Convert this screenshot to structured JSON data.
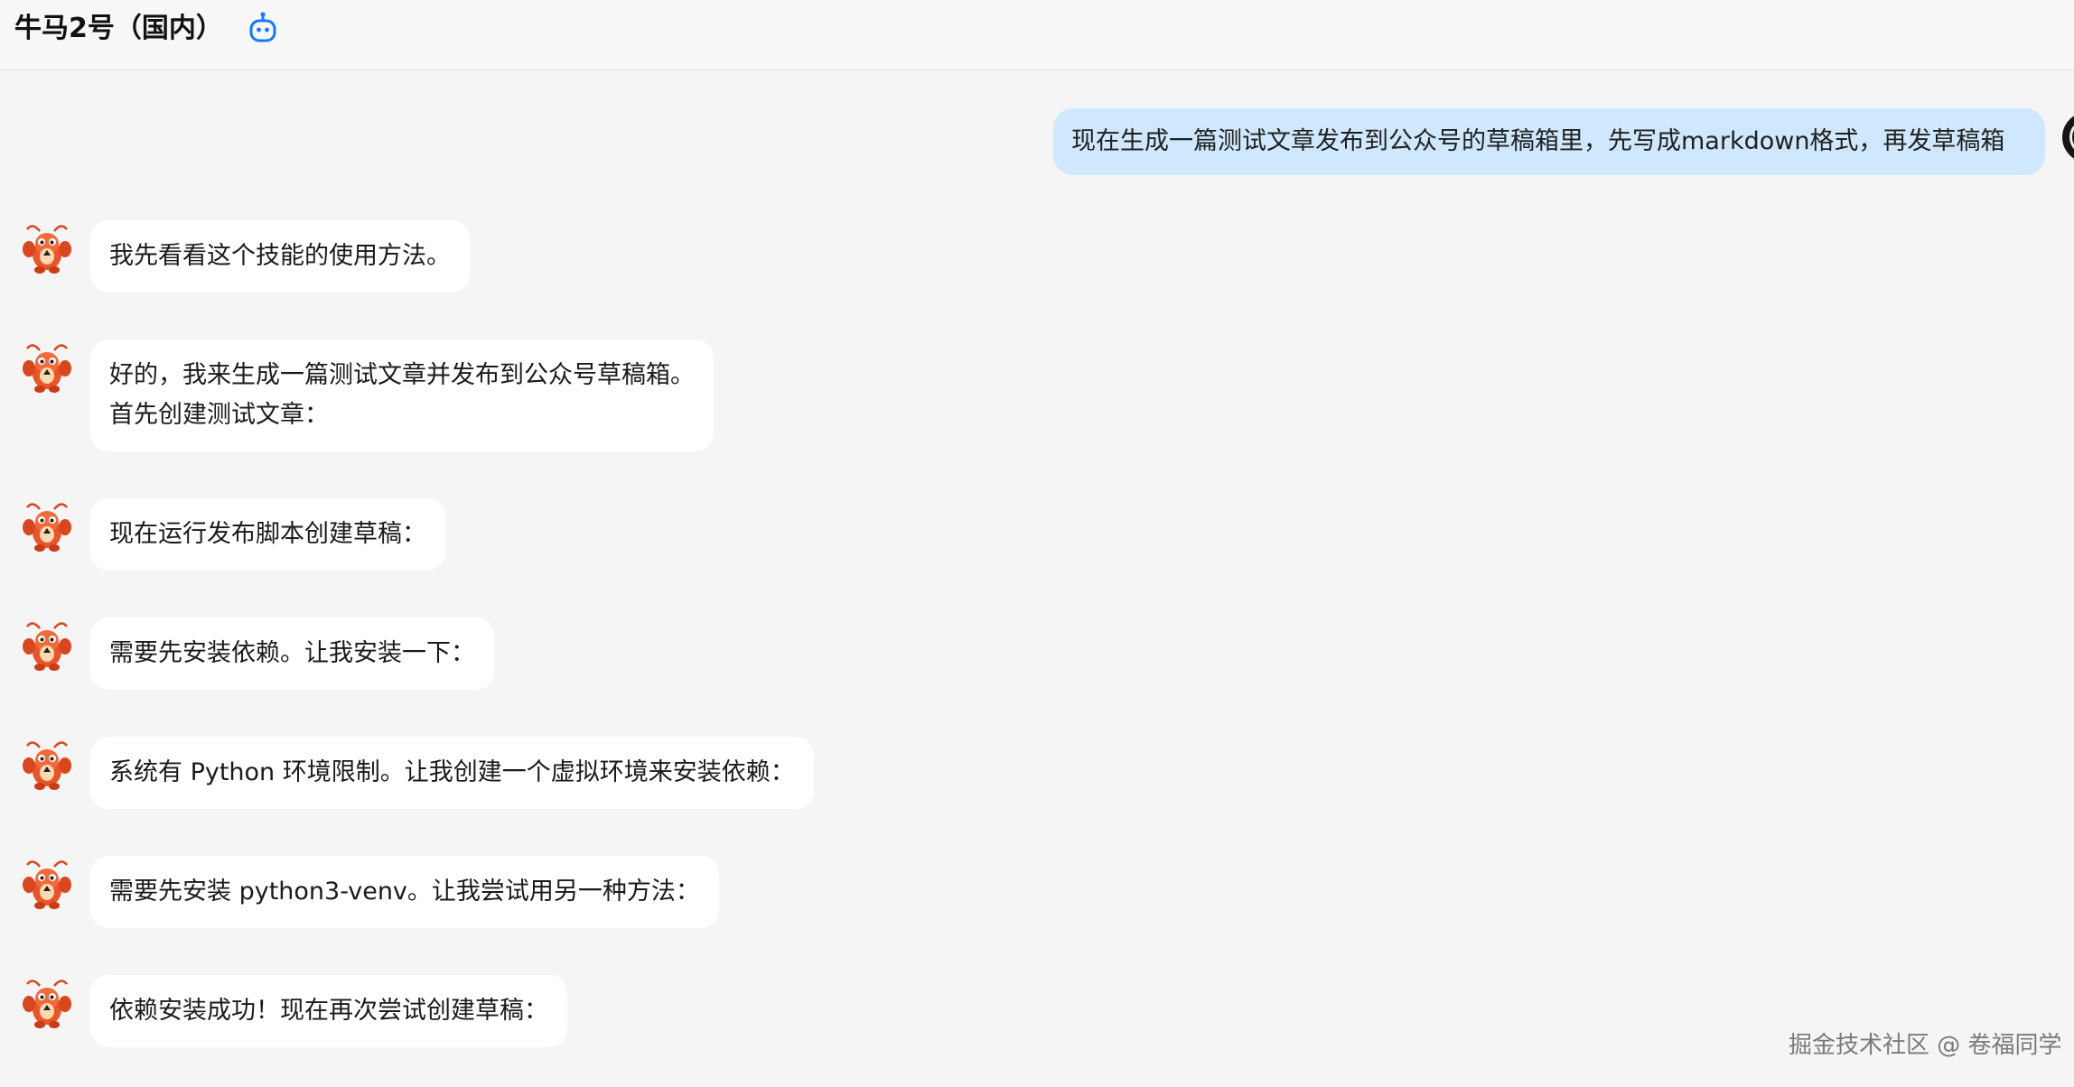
{
  "header": {
    "title": "牛马2号（国内）",
    "bot_icon": "robot-icon",
    "accent_color": "#1677ff"
  },
  "messages": {
    "user": {
      "text": "现在生成一篇测试文章发布到公众号的草稿箱里，先写成markdown格式，再发草稿箱",
      "bubble_color": "#cfe8fd"
    },
    "bot": [
      {
        "text": "我先看看这个技能的使用方法。"
      },
      {
        "text": "好的，我来生成一篇测试文章并发布到公众号草稿箱。\n首先创建测试文章："
      },
      {
        "text": "现在运行发布脚本创建草稿："
      },
      {
        "text": "需要先安装依赖。让我安装一下："
      },
      {
        "text": "系统有 Python 环境限制。让我创建一个虚拟环境来安装依赖："
      },
      {
        "text": "需要先安装 python3-venv。让我尝试用另一种方法："
      },
      {
        "text": "依赖安装成功！现在再次尝试创建草稿："
      }
    ],
    "bot_avatar_icon": "lobster-mascot-icon",
    "user_avatar_icon": "user-avatar-icon"
  },
  "watermark": "掘金技术社区 @ 卷福同学"
}
